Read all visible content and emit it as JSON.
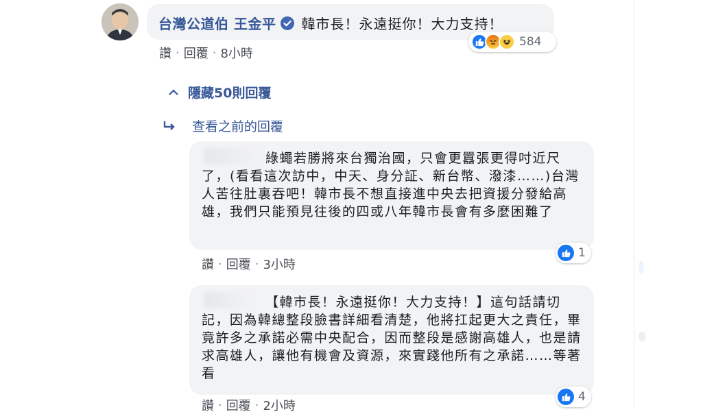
{
  "colors": {
    "link": "#365899",
    "bubble": "#f2f3f5",
    "like_blue": "#1877f2",
    "text_meta": "#4b4f56"
  },
  "top_comment": {
    "author": "台灣公道伯 王金平",
    "text": "韓市長！永遠挺你！大力支持！",
    "reactions": {
      "types": [
        "like-icon",
        "angry-icon",
        "haha-icon"
      ],
      "count": "584"
    },
    "actions": {
      "like": "讚",
      "reply": "回覆",
      "time": "8小時"
    }
  },
  "hide_replies": "隱藏50則回覆",
  "view_previous": "查看之前的回覆",
  "replies": [
    {
      "text": "綠蠅若勝將來台獨治國，只會更囂張更得吋近尺了，(看看這次訪中，中天、身分証、新台幣、潑漆……)台灣人苦往肚裏吞吧！韓市長不想直接進中央去把資援分發給高雄，我們只能預見往後的四或八年韓市長會有多麼困難了",
      "likes": "1",
      "actions": {
        "like": "讚",
        "reply": "回覆",
        "time": "3小時"
      }
    },
    {
      "text": "【韓市長！永遠挺你！大力支持！】這句話請切記，因為韓總整段臉書詳細看清楚，他將扛起更大之責任，畢竟許多之承諾必需中央配合，因而整段是感謝高雄人，也是請求高雄人，讓他有機會及資源，來實踐他所有之承諾……等著看",
      "likes": "4",
      "actions": {
        "like": "讚",
        "reply": "回覆",
        "time": "2小時"
      }
    }
  ]
}
